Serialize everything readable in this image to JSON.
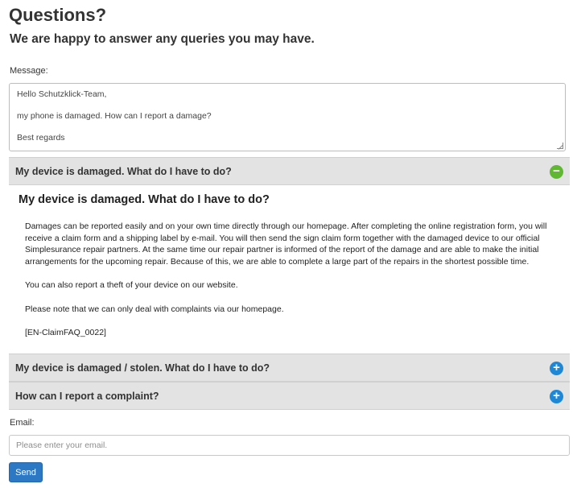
{
  "header": {
    "title": "Questions?",
    "subtitle": "We are happy to answer any queries you may have."
  },
  "message": {
    "label": "Message:",
    "lines": [
      "Hello Schutzklick-Team,",
      "my phone is damaged. How can I report a damage?",
      "Best regards"
    ]
  },
  "accordion": {
    "open_item": {
      "header": "My device is damaged. What do I have to do?",
      "icon": "minus-circle-icon",
      "body_title": "My device is damaged. What do I have to do?",
      "paragraphs": [
        "Damages can be reported easily and on your own time directly through our homepage. After completing the online registration form, you will receive a claim form and a shipping label by e-mail. You will then send the sign claim form together with the damaged device to our official Simplesurance repair partners. At the same time our repair partner is informed of the report of the damage and are able to make the initial arrangements for the upcoming repair. Because of this, we are able to complete a large part of the repairs in the shortest possible time.",
        "You can also report a theft of your device on our website.",
        "Please note that we can only deal with complaints via our homepage.",
        "[EN-ClaimFAQ_0022]"
      ]
    },
    "closed_items": [
      {
        "header": "My device is damaged / stolen. What do I have to do?",
        "icon": "plus-circle-icon"
      },
      {
        "header": "How can I report a complaint?",
        "icon": "plus-circle-icon"
      }
    ]
  },
  "email": {
    "label": "Email:",
    "placeholder": "Please enter your email.",
    "value": ""
  },
  "send_button": {
    "label": "Send"
  },
  "colors": {
    "accordion_header_bg": "#e3e3e3",
    "minus_icon": "#5fb830",
    "plus_icon": "#1e88d6",
    "button": "#2d78c4"
  }
}
